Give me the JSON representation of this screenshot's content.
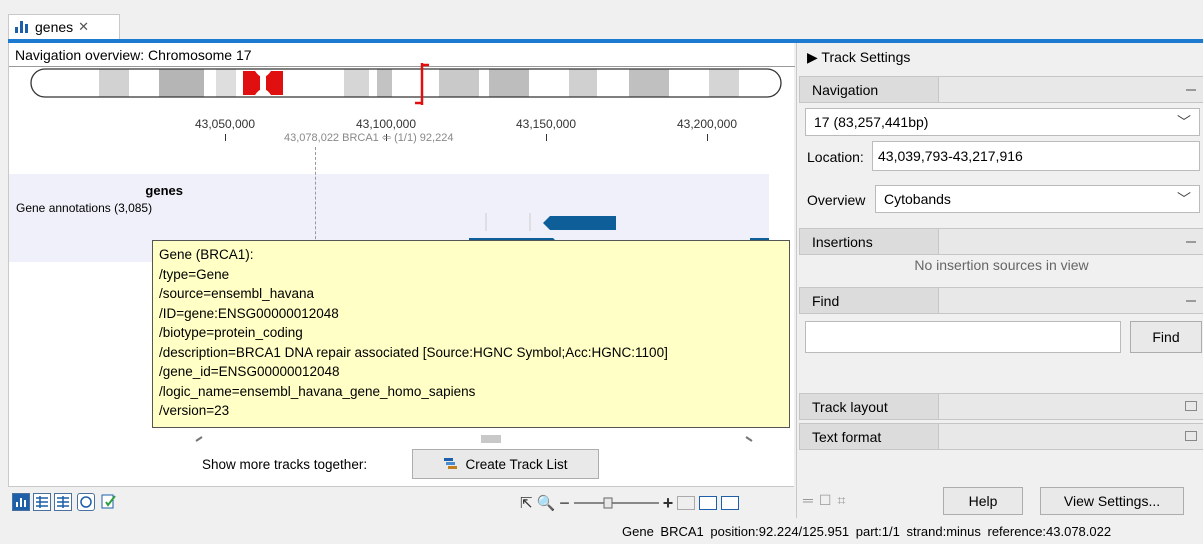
{
  "tab": {
    "label": "genes",
    "close_glyph": "✕",
    "icon": "bar-chart-icon"
  },
  "navigation_overview": {
    "title": "Navigation overview: Chromosome 17"
  },
  "ruler": {
    "ticks": [
      "43,050,000",
      "43,100,000",
      "43,150,000",
      "43,200,000"
    ],
    "cursor_info": "43,078,022 BRCA1  ⇦ (1/1) 92,224"
  },
  "track": {
    "title": "genes",
    "subtitle": "Gene annotations (3,085)",
    "buttons": [
      "grid-icon",
      "arrow-left-circle-icon",
      "arrow-right-circle-icon"
    ]
  },
  "tooltip": {
    "lines": [
      "Gene (BRCA1):",
      "/type=Gene",
      "/source=ensembl_havana",
      "/ID=gene:ENSG00000012048",
      "/biotype=protein_coding",
      "/description=BRCA1 DNA repair associated [Source:HGNC Symbol;Acc:HGNC:1100]",
      "/gene_id=ENSG00000012048",
      "/logic_name=ensembl_havana_gene_homo_sapiens",
      "/version=23"
    ]
  },
  "show_more": {
    "label": "Show more tracks together:",
    "button": "Create Track List"
  },
  "zoom": {
    "minus": "−",
    "plus": "+"
  },
  "right_panel": {
    "title": "Track Settings",
    "navigation": {
      "header": "Navigation",
      "chromosome": "17 (83,257,441bp)",
      "location_label": "Location:",
      "location_value": "43,039,793-43,217,916",
      "overview_label": "Overview",
      "overview_value": "Cytobands"
    },
    "insertions": {
      "header": "Insertions",
      "empty": "No insertion sources in view"
    },
    "find": {
      "header": "Find",
      "button": "Find",
      "value": ""
    },
    "track_layout": {
      "header": "Track layout"
    },
    "text_format": {
      "header": "Text format"
    },
    "help_button": "Help",
    "view_settings_button": "View Settings..."
  },
  "status": {
    "text": "Gene  BRCA1  position:92.224/125.951  part:1/1  strand:minus  reference:43.078.022"
  },
  "colors": {
    "accent": "#1c7bd1",
    "gene": "#0e5e9a",
    "centromere": "#e01010",
    "tooltip_bg": "#ffffc6"
  }
}
